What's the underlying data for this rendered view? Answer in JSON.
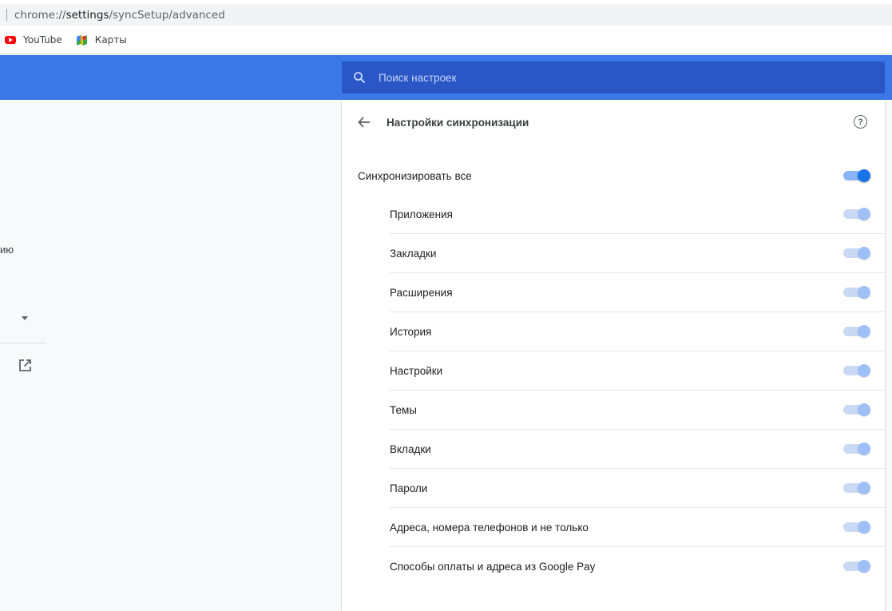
{
  "address_bar": {
    "url_prefix": "chrome://",
    "url_host": "settings",
    "url_path": "/syncSetup/advanced"
  },
  "bookmarks": [
    {
      "label": "YouTube",
      "icon": "youtube-icon"
    },
    {
      "label": "Карты",
      "icon": "maps-icon"
    }
  ],
  "header": {
    "search_placeholder": "Поиск настроек",
    "search_icon": "search-icon"
  },
  "left_nav": {
    "snippet_text": "ию",
    "dropdown_icon": "dropdown-arrow-icon",
    "external_icon": "open-in-new-icon"
  },
  "sync_page": {
    "title": "Настройки синхронизации",
    "back_icon": "arrow-back-icon",
    "help_icon": "help-icon",
    "sync_all": {
      "label": "Синхронизировать все",
      "checked": true
    },
    "items": [
      {
        "label": "Приложения",
        "checked": true,
        "disabled": true
      },
      {
        "label": "Закладки",
        "checked": true,
        "disabled": true
      },
      {
        "label": "Расширения",
        "checked": true,
        "disabled": true
      },
      {
        "label": "История",
        "checked": true,
        "disabled": true
      },
      {
        "label": "Настройки",
        "checked": true,
        "disabled": true
      },
      {
        "label": "Темы",
        "checked": true,
        "disabled": true
      },
      {
        "label": "Вкладки",
        "checked": true,
        "disabled": true
      },
      {
        "label": "Пароли",
        "checked": true,
        "disabled": true
      },
      {
        "label": "Адреса, номера телефонов и не только",
        "checked": true,
        "disabled": true
      },
      {
        "label": "Способы оплаты и адреса из Google Pay",
        "checked": true,
        "disabled": true
      }
    ]
  },
  "colors": {
    "header_blue": "#3b78e7",
    "search_blue": "#2a56c6",
    "toggle_on": "#1a73e8",
    "toggle_disabled": "#9fc0f6"
  }
}
